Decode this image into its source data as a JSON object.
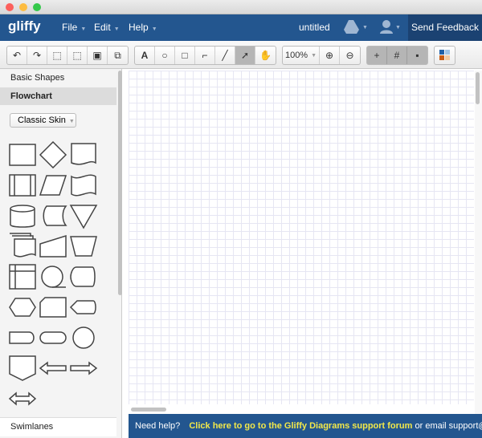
{
  "nav": {
    "logo": "gliffy",
    "menus": [
      {
        "label": "File"
      },
      {
        "label": "Edit"
      },
      {
        "label": "Help"
      }
    ],
    "doc_title": "untitled",
    "feedback": "Send Feedback"
  },
  "toolbar": {
    "zoom": "100%"
  },
  "sidebar": {
    "sections": [
      "Basic Shapes",
      "Flowchart",
      "Swimlanes"
    ],
    "skin": "Classic Skin",
    "shapes": [
      "process",
      "decision",
      "document",
      "predefined-process",
      "data",
      "tape",
      "database",
      "stored-data",
      "merge",
      "multi-document",
      "manual-input",
      "manual-operation",
      "internal-storage",
      "sequential-data",
      "display",
      "preparation",
      "card",
      "display-alt",
      "delay",
      "terminator",
      "connector",
      "off-page-connector",
      "arrow-left",
      "arrow-right",
      "arrow-double"
    ]
  },
  "footer": {
    "help": "Need help?",
    "link": "Click here to go to the Gliffy Diagrams support forum",
    "email": "or email support@gliffy.com"
  },
  "colors": {
    "nav": "#23568f",
    "feedback": "#1b4272",
    "link": "#f2e84a"
  }
}
